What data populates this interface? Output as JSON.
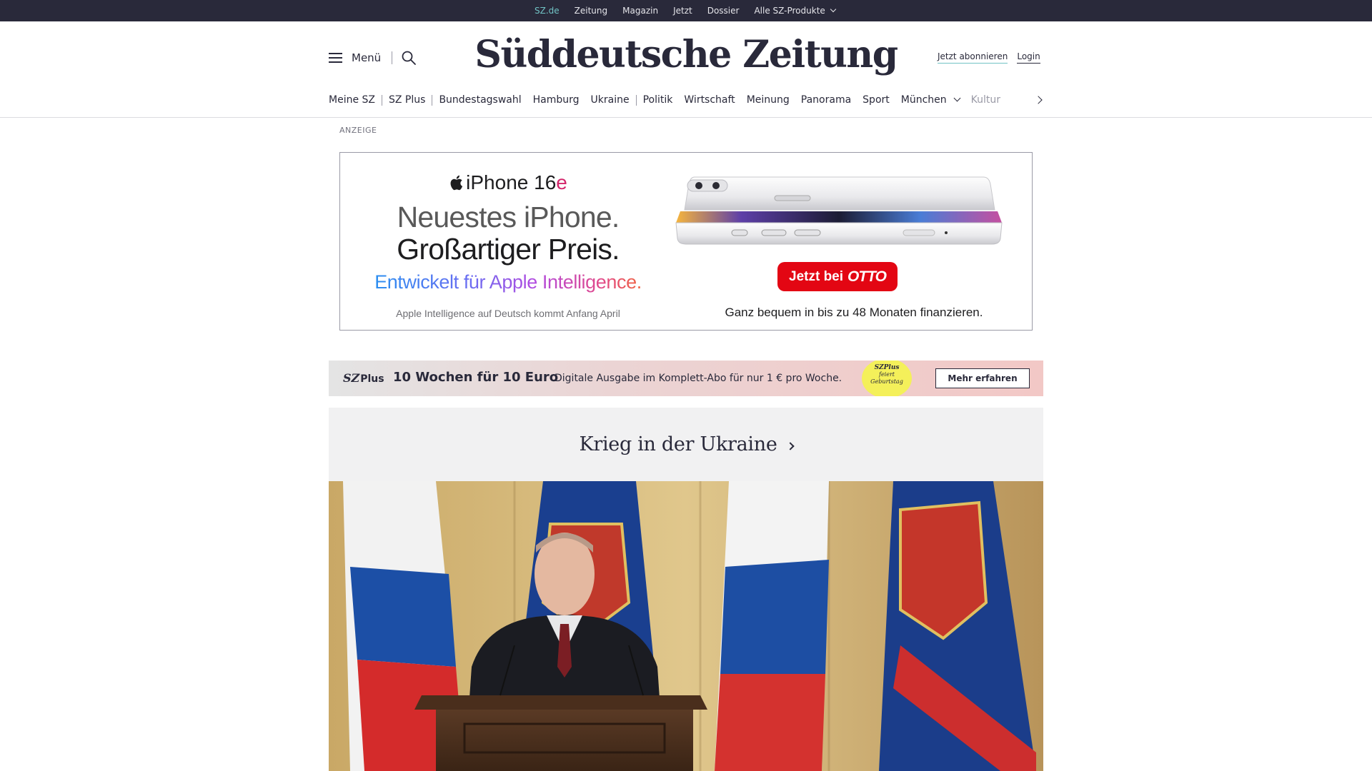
{
  "topbar": {
    "links": [
      {
        "label": "SZ.de",
        "active": true
      },
      {
        "label": "Zeitung"
      },
      {
        "label": "Magazin"
      },
      {
        "label": "Jetzt"
      },
      {
        "label": "Dossier"
      },
      {
        "label": "Alle SZ-Produkte"
      }
    ]
  },
  "header": {
    "menu_label": "Menü",
    "logo_text": "Süddeutsche Zeitung",
    "subscribe_label": "Jetzt abonnieren",
    "login_label": "Login"
  },
  "nav": {
    "items": [
      "Meine SZ",
      "SZ Plus",
      "Bundestagswahl",
      "Hamburg",
      "Ukraine",
      "Politik",
      "Wirtschaft",
      "Meinung",
      "Panorama",
      "Sport",
      "München",
      "Kultur"
    ]
  },
  "ad": {
    "label": "ANZEIGE",
    "brand_main": "iPhone 16",
    "brand_suffix": "e",
    "headline_1": "Neuestes iPhone.",
    "headline_2": "Großartiger Preis.",
    "tagline": "Entwickelt für Apple Intelligence.",
    "footnote_left": "Apple Intelligence auf Deutsch kommt Anfang April",
    "cta_prefix": "Jetzt bei",
    "cta_brand": "OTTO",
    "footnote_right": "Ganz bequem in bis zu 48 Monaten finanzieren."
  },
  "plus_banner": {
    "logo_main": "SZ",
    "logo_suffix": "Plus",
    "title": "10 Wochen für 10 Euro",
    "description": "Digitale Ausgabe im Komplett-Abo für nur 1 € pro Woche.",
    "badge_line1": "SZPlus",
    "badge_line2": "feiert",
    "badge_line3": "Geburtstag",
    "cta_label": "Mehr erfahren"
  },
  "section": {
    "title": "Krieg in der Ukraine"
  },
  "colors": {
    "ink": "#29293a",
    "accent": "#71c3c5",
    "otto_red": "#e30613"
  }
}
